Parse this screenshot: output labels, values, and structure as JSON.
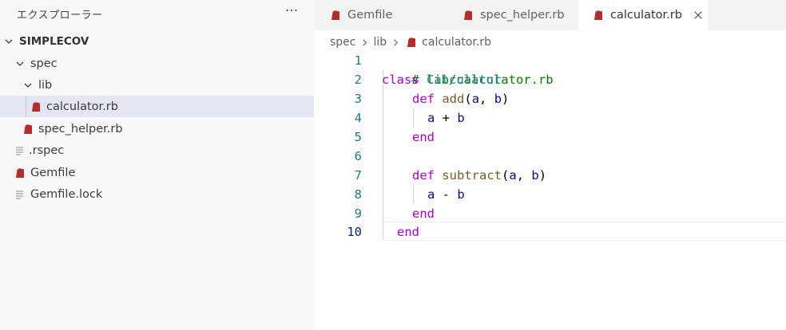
{
  "explorer": {
    "title": "エクスプローラー",
    "more_label": "···",
    "root": "SIMPLECOV",
    "items": [
      {
        "label": "spec"
      },
      {
        "label": "lib"
      },
      {
        "label": "calculator.rb"
      },
      {
        "label": "spec_helper.rb"
      },
      {
        "label": ".rspec"
      },
      {
        "label": "Gemfile"
      },
      {
        "label": "Gemfile.lock"
      }
    ]
  },
  "tabs": [
    {
      "label": "Gemfile"
    },
    {
      "label": "spec_helper.rb"
    },
    {
      "label": "calculator.rb"
    }
  ],
  "breadcrumb": [
    "spec",
    "lib",
    "calculator.rb"
  ],
  "editor": {
    "current_line": 10,
    "line_numbers": [
      "1",
      "2",
      "3",
      "4",
      "5",
      "6",
      "7",
      "8",
      "9",
      "10"
    ],
    "lines": {
      "l1_comment": "# lib/calculator.rb",
      "l2_kw": "class",
      "l2_name": "Calculator",
      "l3_kw": "def",
      "l3_fn": "add",
      "l3_open": "(",
      "l3_a": "a",
      "l3_comma": ", ",
      "l3_b": "b",
      "l3_close": ")",
      "l4_a": "a",
      "l4_op": " + ",
      "l4_b": "b",
      "l5_end": "end",
      "l7_kw": "def",
      "l7_fn": "subtract",
      "l7_open": "(",
      "l7_a": "a",
      "l7_comma": ", ",
      "l7_b": "b",
      "l7_close": ")",
      "l8_a": "a",
      "l8_op": " - ",
      "l8_b": "b",
      "l9_end": "end",
      "l10_end": "end"
    }
  },
  "colors": {
    "ruby_icon": "#b32d2e",
    "selection": "#e4e6f1",
    "keyword": "#af00db",
    "class_name": "#267f99",
    "function": "#795e26",
    "comment": "#008000",
    "line_number": "#237893"
  },
  "icons": {
    "ruby_file": "ruby-file-icon",
    "text_file": "lines-file-icon",
    "chevron_down": "chevron-down-icon",
    "chevron_right": "chevron-right-icon",
    "close": "close-icon"
  }
}
